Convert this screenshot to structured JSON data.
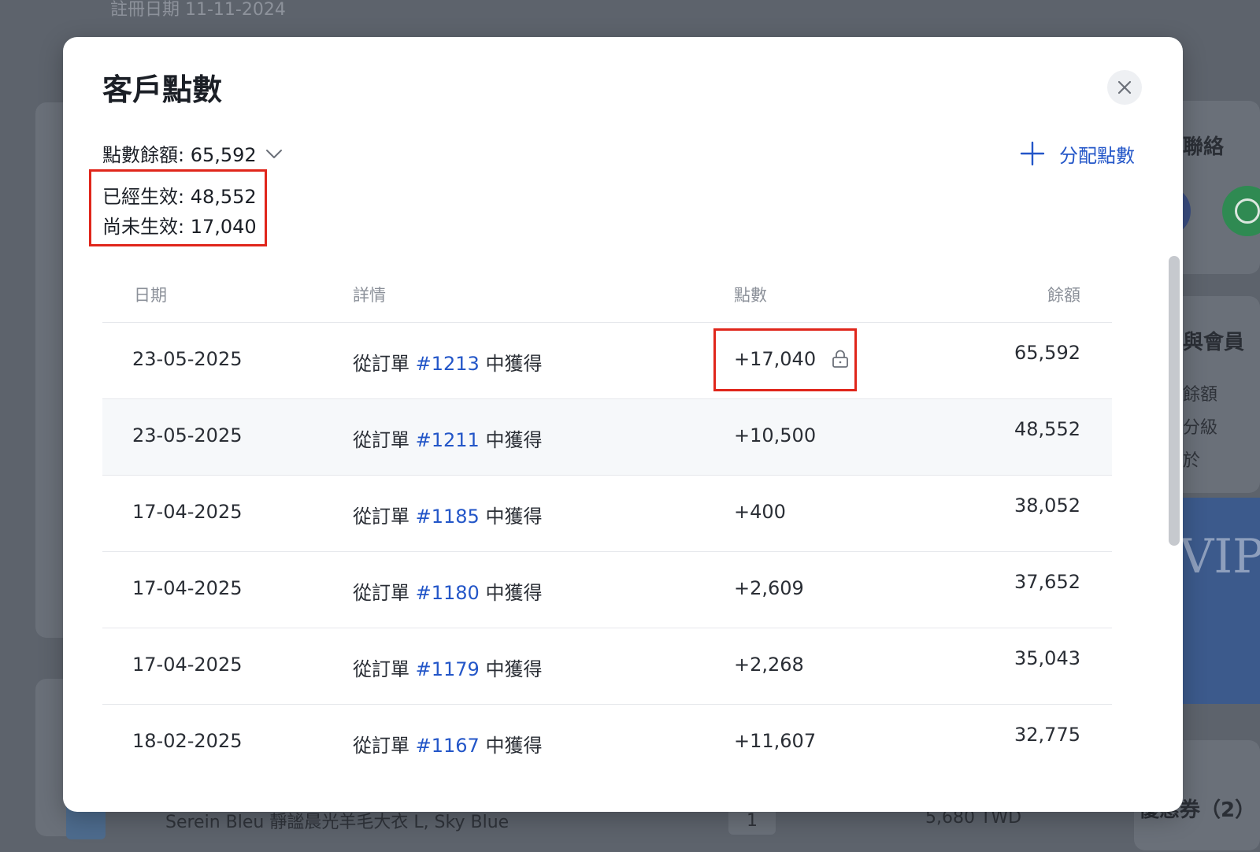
{
  "background": {
    "registration_date": "註冊日期 11-11-2024",
    "contact_heading": "聯絡",
    "membership_heading": "與會員",
    "membership_items": [
      "餘額",
      "分級",
      "於"
    ],
    "vip_label": "VIP",
    "coupons_heading": "優惠券（2）",
    "product_name": "Serein Bleu 靜謐晨光羊毛大衣 L, Sky Blue",
    "product_qty": "1",
    "product_price": "5,680 TWD"
  },
  "modal": {
    "title": "客戶點數",
    "close_icon": "close-icon",
    "balance_label": "點數餘額: 65,592",
    "effective_label": "已經生效: 48,552",
    "pending_label": "尚未生效: 17,040",
    "assign_button": "分配點數",
    "accent_color": "#2356c8",
    "highlight_color": "#e0261b"
  },
  "table": {
    "headers": {
      "date": "日期",
      "detail": "詳情",
      "points": "點數",
      "balance": "餘額"
    },
    "rows": [
      {
        "date": "23-05-2025",
        "prefix": "從訂單",
        "order": "#1213",
        "suffix": "中獲得",
        "points": "+17,040",
        "balance": "65,592",
        "locked": true
      },
      {
        "date": "23-05-2025",
        "prefix": "從訂單",
        "order": "#1211",
        "suffix": "中獲得",
        "points": "+10,500",
        "balance": "48,552",
        "locked": false
      },
      {
        "date": "17-04-2025",
        "prefix": "從訂單",
        "order": "#1185",
        "suffix": "中獲得",
        "points": "+400",
        "balance": "38,052",
        "locked": false
      },
      {
        "date": "17-04-2025",
        "prefix": "從訂單",
        "order": "#1180",
        "suffix": "中獲得",
        "points": "+2,609",
        "balance": "37,652",
        "locked": false
      },
      {
        "date": "17-04-2025",
        "prefix": "從訂單",
        "order": "#1179",
        "suffix": "中獲得",
        "points": "+2,268",
        "balance": "35,043",
        "locked": false
      },
      {
        "date": "18-02-2025",
        "prefix": "從訂單",
        "order": "#1167",
        "suffix": "中獲得",
        "points": "+11,607",
        "balance": "32,775",
        "locked": false
      }
    ]
  }
}
